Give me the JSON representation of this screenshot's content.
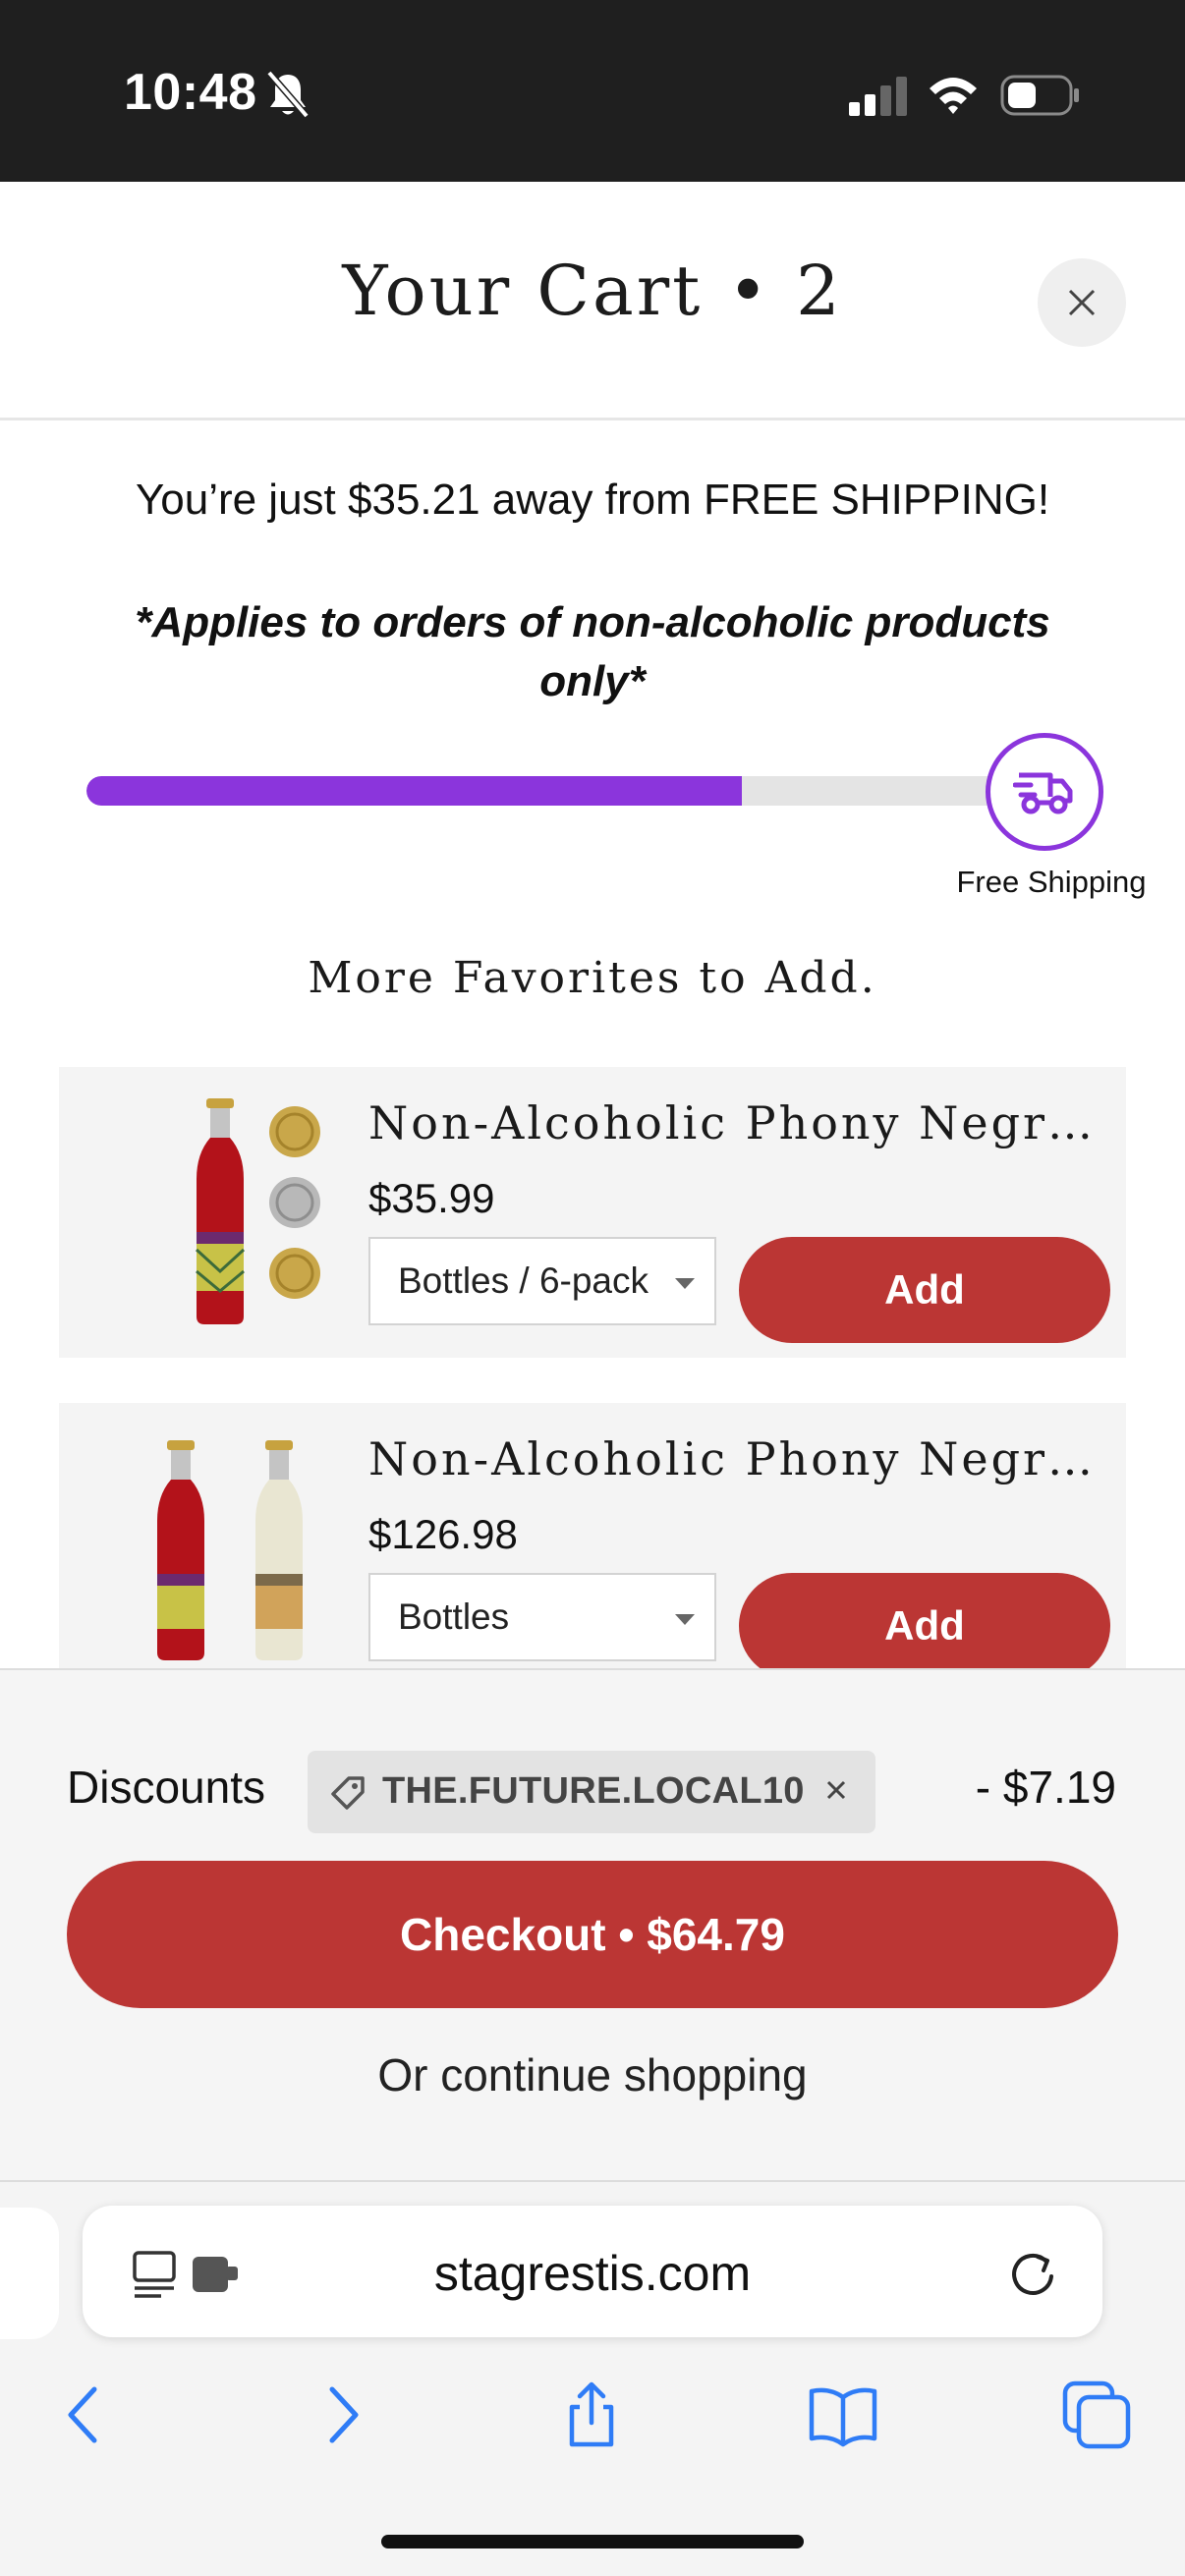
{
  "status_bar": {
    "time": "10:48"
  },
  "cart": {
    "title": "Your Cart • 2"
  },
  "shipping": {
    "message": "You’re just $35.21 away from FREE SHIPPING!",
    "applies": "*Applies to orders of non-alcoholic products only*",
    "progress": 0.71,
    "label": "Free Shipping"
  },
  "favorites": {
    "title": "More Favorites to Add.",
    "items": [
      {
        "name": "Non-Alcoholic Phony Negroni...",
        "price": "$35.99",
        "option": "Bottles / 6-pack",
        "button": "Add"
      },
      {
        "name": "Non-Alcoholic Phony Negroni...",
        "price": "$126.98",
        "option": "Bottles",
        "button": "Add"
      }
    ]
  },
  "footer": {
    "discounts_label": "Discounts",
    "discount_code": "THE.FUTURE.LOCAL10",
    "discount_amount": "- $7.19",
    "checkout": "Checkout • $64.79",
    "continue": "Or continue shopping"
  },
  "browser": {
    "url": "stagrestis.com"
  },
  "colors": {
    "accent_red": "#bb3634",
    "progress_purple": "#8b35dc",
    "ios_blue": "#2f7cf6"
  }
}
